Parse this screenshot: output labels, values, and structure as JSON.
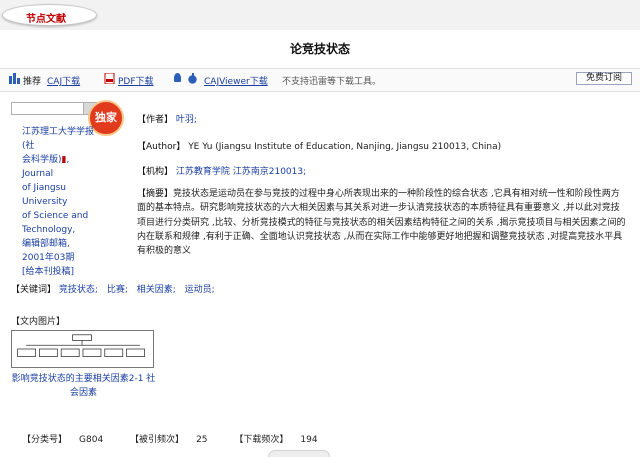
{
  "header": {
    "badge_label": "节点文献",
    "title": "论竞技状态"
  },
  "toolbar": {
    "recommend": "推荐",
    "caj_download": "CAJ下载",
    "pdf_download": "PDF下载",
    "cajviewer_download": "CAJViewer下载",
    "note": "不支持迅雷等下载工具。",
    "subscribe": "免费订阅"
  },
  "left": {
    "stamp": "独家",
    "source_lines": [
      "江苏理工大学学报(社",
      "会科学版)",
      "Journal",
      "of Jiangsu University",
      "of Science and",
      "Technology,",
      "编辑部邮箱,",
      "2001年03期",
      "[给本刊投稿]"
    ]
  },
  "article": {
    "author_label": "【作者】",
    "author": "叶羽;",
    "author_en_label": "【Author】",
    "author_en": "YE Yu (Jiangsu Institute of Education, Nanjing, Jiangsu 210013, China)",
    "institution_label": "【机构】",
    "institution": "江苏教育学院  江苏南京210013;",
    "abstract_label": "【摘要】",
    "abstract": "竞技状态是运动员在参与竞技的过程中身心所表现出来的一种阶段性的综合状态 ,它具有相对统一性和阶段性两方面的基本特点。研究影响竞技状态的六大相关因素与其关系对进一步认清竞技状态的本质特征具有重要意义 ,并以此对竞技项目进行分类研究 ,比较、分析竞技模式的特征与竞技状态的相关因素结构特征之间的关系 ,揭示竞技项目与相关因素之间的内在联系和规律 ,有利于正确、全面地认识竞技状态 ,从而在实际工作中能够更好地把握和调整竞技状态 ,对提高竞技水平具有积极的意义",
    "keywords_label": "【关键词】",
    "keywords": [
      "竞技状态;",
      "比赛;",
      "相关因素;",
      "运动员;"
    ]
  },
  "figures": {
    "label": "【文内图片】",
    "caption": "影响竞技状态的主要相关因素2-1  社会因素"
  },
  "footer": {
    "class_label": "【分类号】",
    "class_value": "G804",
    "cited_label": "【被引频次】",
    "cited_value": "25",
    "download_label": "【下载频次】",
    "download_value": "194"
  },
  "colors": {
    "link": "#1a3fa0",
    "accent_red": "#c00000",
    "stamp": "#e23a1c"
  }
}
